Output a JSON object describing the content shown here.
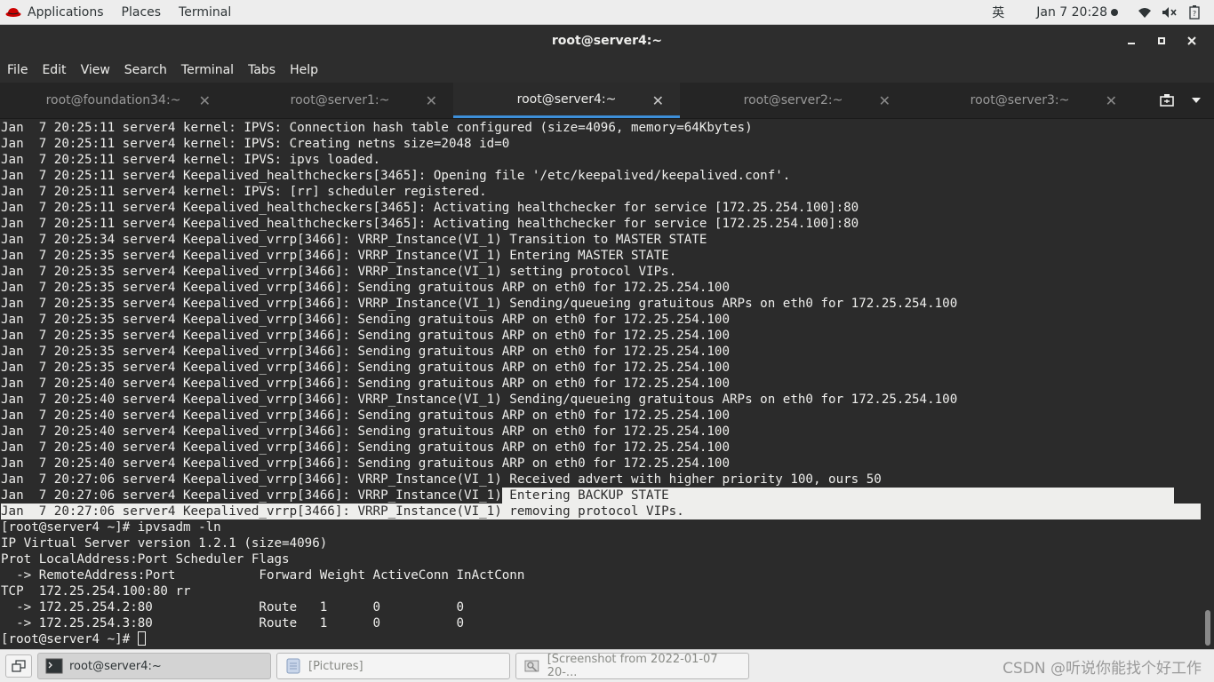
{
  "topbar": {
    "applications": "Applications",
    "places": "Places",
    "terminal": "Terminal",
    "ime": "英",
    "clock": "Jan 7  20:28",
    "icons": [
      "redhat-logo",
      "wifi-icon",
      "volume-mute-icon",
      "battery-icon"
    ]
  },
  "window": {
    "title": "root@server4:~",
    "buttons": [
      "minimize",
      "maximize",
      "close"
    ]
  },
  "menu": {
    "items": [
      "File",
      "Edit",
      "View",
      "Search",
      "Terminal",
      "Tabs",
      "Help"
    ]
  },
  "tabs": [
    {
      "label": "root@foundation34:~",
      "active": false
    },
    {
      "label": "root@server1:~",
      "active": false
    },
    {
      "label": "root@server4:~",
      "active": true
    },
    {
      "label": "root@server2:~",
      "active": false
    },
    {
      "label": "root@server3:~",
      "active": false
    }
  ],
  "terminal": {
    "lines": [
      "Jan  7 20:25:11 server4 kernel: IPVS: Connection hash table configured (size=4096, memory=64Kbytes)",
      "Jan  7 20:25:11 server4 kernel: IPVS: Creating netns size=2048 id=0",
      "Jan  7 20:25:11 server4 kernel: IPVS: ipvs loaded.",
      "Jan  7 20:25:11 server4 Keepalived_healthcheckers[3465]: Opening file '/etc/keepalived/keepalived.conf'.",
      "Jan  7 20:25:11 server4 kernel: IPVS: [rr] scheduler registered.",
      "Jan  7 20:25:11 server4 Keepalived_healthcheckers[3465]: Activating healthchecker for service [172.25.254.100]:80",
      "Jan  7 20:25:11 server4 Keepalived_healthcheckers[3465]: Activating healthchecker for service [172.25.254.100]:80",
      "Jan  7 20:25:34 server4 Keepalived_vrrp[3466]: VRRP_Instance(VI_1) Transition to MASTER STATE",
      "Jan  7 20:25:35 server4 Keepalived_vrrp[3466]: VRRP_Instance(VI_1) Entering MASTER STATE",
      "Jan  7 20:25:35 server4 Keepalived_vrrp[3466]: VRRP_Instance(VI_1) setting protocol VIPs.",
      "Jan  7 20:25:35 server4 Keepalived_vrrp[3466]: Sending gratuitous ARP on eth0 for 172.25.254.100",
      "Jan  7 20:25:35 server4 Keepalived_vrrp[3466]: VRRP_Instance(VI_1) Sending/queueing gratuitous ARPs on eth0 for 172.25.254.100",
      "Jan  7 20:25:35 server4 Keepalived_vrrp[3466]: Sending gratuitous ARP on eth0 for 172.25.254.100",
      "Jan  7 20:25:35 server4 Keepalived_vrrp[3466]: Sending gratuitous ARP on eth0 for 172.25.254.100",
      "Jan  7 20:25:35 server4 Keepalived_vrrp[3466]: Sending gratuitous ARP on eth0 for 172.25.254.100",
      "Jan  7 20:25:35 server4 Keepalived_vrrp[3466]: Sending gratuitous ARP on eth0 for 172.25.254.100",
      "Jan  7 20:25:40 server4 Keepalived_vrrp[3466]: Sending gratuitous ARP on eth0 for 172.25.254.100",
      "Jan  7 20:25:40 server4 Keepalived_vrrp[3466]: VRRP_Instance(VI_1) Sending/queueing gratuitous ARPs on eth0 for 172.25.254.100",
      "Jan  7 20:25:40 server4 Keepalived_vrrp[3466]: Sending gratuitous ARP on eth0 for 172.25.254.100",
      "Jan  7 20:25:40 server4 Keepalived_vrrp[3466]: Sending gratuitous ARP on eth0 for 172.25.254.100",
      "Jan  7 20:25:40 server4 Keepalived_vrrp[3466]: Sending gratuitous ARP on eth0 for 172.25.254.100",
      "Jan  7 20:25:40 server4 Keepalived_vrrp[3466]: Sending gratuitous ARP on eth0 for 172.25.254.100",
      "Jan  7 20:27:06 server4 Keepalived_vrrp[3466]: VRRP_Instance(VI_1) Received advert with higher priority 100, ours 50",
      "Jan  7 20:27:06 server4 Keepalived_vrrp[3466]: VRRP_Instance(VI_1)",
      "Jan  7 20:27:06 server4 Keepalived_vrrp[3466]: VRRP_Instance(VI_1) removing protocol VIPs.",
      "[root@server4 ~]# ipvsadm -ln",
      "IP Virtual Server version 1.2.1 (size=4096)",
      "Prot LocalAddress:Port Scheduler Flags",
      "  -> RemoteAddress:Port           Forward Weight ActiveConn InActConn",
      "TCP  172.25.254.100:80 rr",
      "  -> 172.25.254.2:80              Route   1      0          0",
      "  -> 172.25.254.3:80              Route   1      0          0"
    ],
    "selected_tail": " Entering BACKUP STATE",
    "prompt": "[root@server4 ~]# "
  },
  "panel": {
    "tasks": [
      {
        "label": "root@server4:~",
        "active": true
      },
      {
        "label": "[Pictures]",
        "active": false
      },
      {
        "label": "[Screenshot from 2022-01-07 20-...",
        "active": false
      }
    ],
    "watermark": "CSDN @听说你能找个好工作"
  }
}
